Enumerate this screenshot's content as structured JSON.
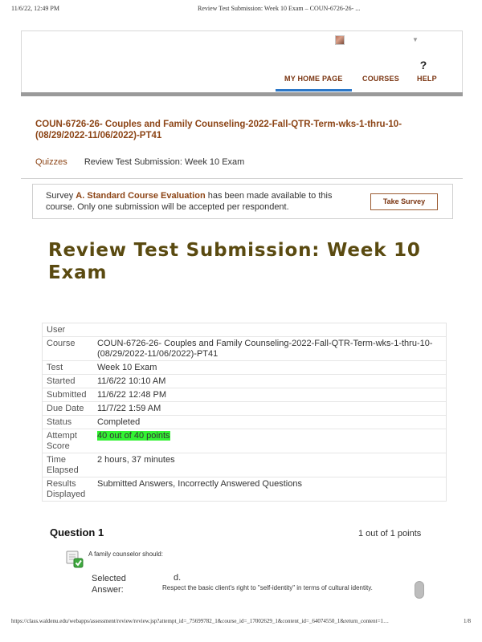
{
  "print_header": {
    "date": "11/6/22, 12:49 PM",
    "title": "Review Test Submission: Week 10 Exam – COUN-6726-26- ..."
  },
  "topbar": {
    "help_glyph": "?",
    "nav": {
      "home": "MY HOME PAGE",
      "courses": "COURSES",
      "help": "HELP"
    },
    "accent_color": "#2b77c8"
  },
  "course_title": "COUN-6726-26- Couples and Family Counseling-2022-Fall-QTR-Term-wks-1-thru-10-(08/29/2022-11/06/2022)-PT41",
  "breadcrumb": {
    "quizzes": "Quizzes",
    "current": "Review Test Submission: Week 10 Exam"
  },
  "survey": {
    "prefix": "Survey ",
    "link": "A. Standard Course Evaluation",
    "suffix": " has been made available to this course. Only one submission will be accepted per respondent.",
    "button": "Take Survey"
  },
  "page_heading": "Review Test Submission: Week 10 Exam",
  "details": {
    "rows": [
      {
        "label": "User",
        "value": ""
      },
      {
        "label": "Course",
        "value": "COUN-6726-26- Couples and Family Counseling-2022-Fall-QTR-Term-wks-1-thru-10-(08/29/2022-11/06/2022)-PT41"
      },
      {
        "label": "Test",
        "value": "Week 10 Exam"
      },
      {
        "label": "Started",
        "value": "11/6/22 10:10 AM"
      },
      {
        "label": "Submitted",
        "value": "11/6/22 12:48 PM"
      },
      {
        "label": "Due Date",
        "value": "11/7/22 1:59 AM"
      },
      {
        "label": "Status",
        "value": "Completed"
      },
      {
        "label": "Attempt Score",
        "value": "40 out of 40 points"
      },
      {
        "label": "Time Elapsed",
        "value": "2 hours, 37 minutes"
      },
      {
        "label": "Results Displayed",
        "value": "Submitted Answers, Incorrectly Answered Questions"
      }
    ]
  },
  "question": {
    "title": "Question 1",
    "points": "1 out of 1 points",
    "text": "A family counselor should:",
    "selected_label": "Selected Answer:",
    "answer_letter": "d.",
    "answer_text": "Respect the basic client's right to \"self-identity\" in terms of cultural identity."
  },
  "print_footer": {
    "url": "https://class.waldenu.edu/webapps/assessment/review/review.jsp?attempt_id=_75699782_1&course_id=_17002629_1&content_id=_64074550_1&return_content=1…",
    "page": "1/8"
  }
}
